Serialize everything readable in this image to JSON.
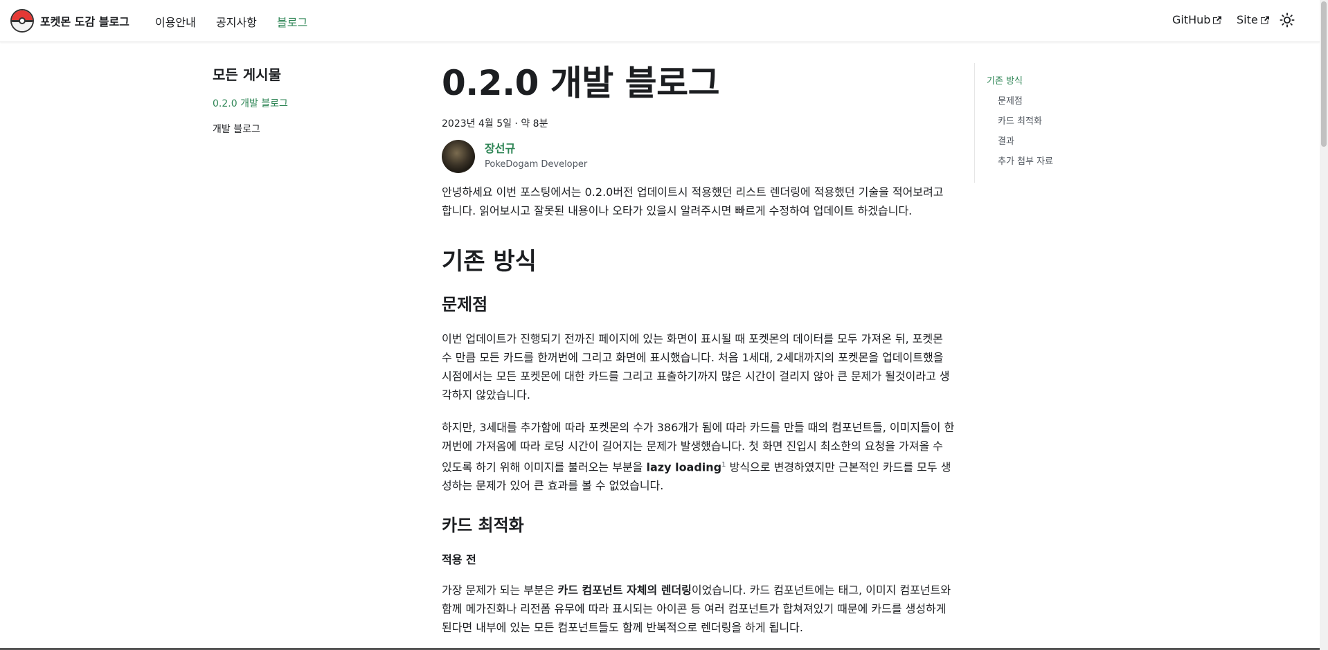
{
  "navbar": {
    "brand": "포켓몬 도감 블로그",
    "links": [
      "이용안내",
      "공지사항",
      "블로그"
    ],
    "active_link": "블로그",
    "right_links": [
      "GitHub",
      "Site"
    ],
    "icons": {
      "logo": "pokeball-icon",
      "external": "external-link-icon",
      "theme": "sun-icon"
    }
  },
  "sidebar": {
    "title": "모든 게시물",
    "items": [
      "0.2.0 개발 블로그",
      "개발 블로그"
    ]
  },
  "article": {
    "title": "0.2.0 개발 블로그",
    "meta": "2023년 4월 5일 · 약 8분",
    "author_name": "장선규",
    "author_role": "PokeDogam Developer",
    "intro": "안녕하세요 이번 포스팅에서는 0.2.0버전 업데이트시 적용했던 리스트 렌더링에 적용했던 기술을 적어보려고 합니다. 읽어보시고 잘못된 내용이나 오타가 있을시 알려주시면 빠르게 수정하여 업데이트 하겠습니다.",
    "h2_existing": "기존 방식",
    "h3_problem": "문제점",
    "p_problem_1": "이번 업데이트가 진행되기 전까진 페이지에 있는 화면이 표시될 때 포켓몬의 데이터를 모두 가져온 뒤, 포켓몬 수 만큼 모든 카드를 한꺼번에 그리고 화면에 표시했습니다. 처음 1세대, 2세대까지의 포켓몬을 업데이트했을 시점에서는 모든 포켓몬에 대한 카드를 그리고 표출하기까지 많은 시간이 걸리지 않아 큰 문제가 될것이라고 생각하지 않았습니다.",
    "p_problem_2_a": "하지만, 3세대를 추가함에 따라 포켓몬의 수가 386개가 됨에 따라 카드를 만들 때의 컴포넌트들, 이미지들이 한꺼번에 가져옴에 따라 로딩 시간이 길어지는 문제가 발생했습니다. 첫 화면 진입시 최소한의 요청을 가져올 수 있도록 하기 위해 이미지를 불러오는 부분을 ",
    "p_problem_2_bold": "lazy loading",
    "p_problem_2_sup": "1",
    "p_problem_2_b": " 방식으로 변경하였지만 근본적인 카드를 모두 생성하는 문제가 있어 큰 효과를 볼 수 없었습니다.",
    "h3_card": "카드 최적화",
    "h4_before": "적용 전",
    "p_card_a": "가장 문제가 되는 부분은 ",
    "p_card_bold": "카드 컴포넌트 자체의 렌더링",
    "p_card_b": "이었습니다. 카드 컴포넌트에는 태그, 이미지 컴포넌트와 함께 메가진화나 리전폼 유무에 따라 표시되는 아이콘 등 여러 컴포넌트가 합쳐져있기 때문에 카드를 생성하게 된다면 내부에 있는 모든 컴포넌트들도 함께 반복적으로 렌더링을 하게 됩니다."
  },
  "toc": {
    "items": [
      "기존 방식",
      "문제점",
      "카드 최적화",
      "결과",
      "추가 첨부 자료"
    ]
  },
  "colors": {
    "accent": "#2e8555",
    "text": "#1c1e21"
  }
}
